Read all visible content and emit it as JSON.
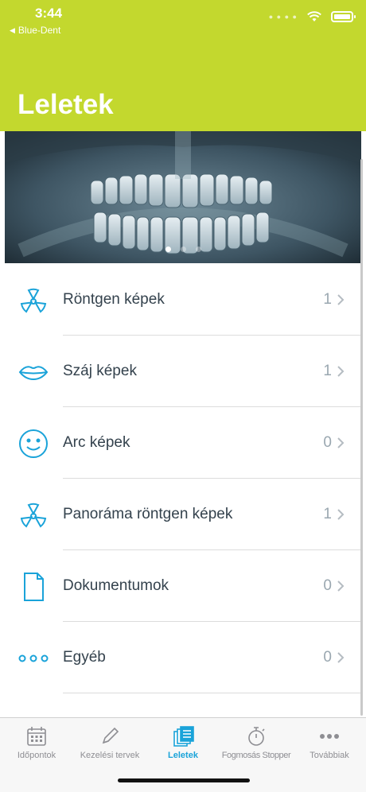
{
  "status_bar": {
    "time": "3:44",
    "back_app": "Blue-Dent"
  },
  "header": {
    "title": "Leletek"
  },
  "banner": {
    "image": "dental-panoramic-xray",
    "page_count": 3,
    "active_page": 1
  },
  "list": {
    "items": [
      {
        "label": "Röntgen képek",
        "count": "1",
        "icon": "radiation-icon"
      },
      {
        "label": "Száj képek",
        "count": "1",
        "icon": "lips-icon"
      },
      {
        "label": "Arc képek",
        "count": "0",
        "icon": "smiley-face-icon"
      },
      {
        "label": "Panoráma röntgen képek",
        "count": "1",
        "icon": "radiation-icon"
      },
      {
        "label": "Dokumentumok",
        "count": "0",
        "icon": "document-icon"
      },
      {
        "label": "Egyéb",
        "count": "0",
        "icon": "more-dots-icon"
      }
    ]
  },
  "tabbar": {
    "tabs": [
      {
        "label": "Időpontok",
        "icon": "calendar-icon",
        "active": false
      },
      {
        "label": "Kezelési tervek",
        "icon": "pencil-icon",
        "active": false
      },
      {
        "label": "Leletek",
        "icon": "documents-stack-icon",
        "active": true
      },
      {
        "label": "Fogmosás Stopper",
        "icon": "stopwatch-icon",
        "active": false
      },
      {
        "label": "Továbbiak",
        "icon": "more-icon",
        "active": false
      }
    ]
  },
  "colors": {
    "header_green": "#c3d82e",
    "accent_blue": "#1aa3d9",
    "text_dark": "#34424d",
    "count_gray": "#9aa7b0"
  }
}
